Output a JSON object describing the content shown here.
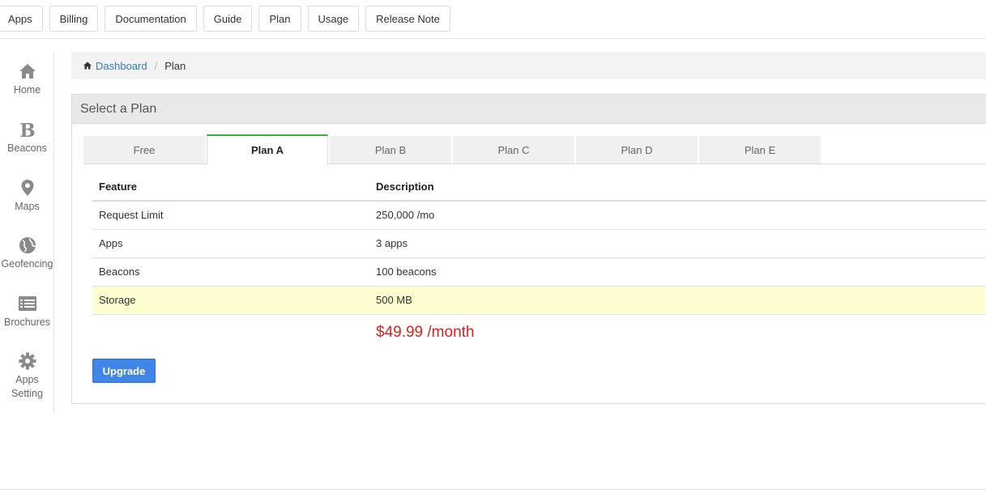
{
  "topnav": {
    "items": [
      {
        "label": "Apps"
      },
      {
        "label": "Billing"
      },
      {
        "label": "Documentation"
      },
      {
        "label": "Guide"
      },
      {
        "label": "Plan"
      },
      {
        "label": "Usage"
      },
      {
        "label": "Release Note"
      }
    ]
  },
  "sidebar": {
    "items": [
      {
        "label": "Home",
        "icon": "home-icon"
      },
      {
        "label": "Beacons",
        "icon": "beacon-b-icon"
      },
      {
        "label": "Maps",
        "icon": "map-pin-icon"
      },
      {
        "label": "Geofencing",
        "icon": "globe-icon"
      },
      {
        "label": "Brochures",
        "icon": "list-icon"
      },
      {
        "label": "Apps",
        "label2": "Setting",
        "icon": "gear-icon"
      }
    ]
  },
  "breadcrumb": {
    "home": "Dashboard",
    "separator": "/",
    "current": "Plan"
  },
  "panel": {
    "title": "Select a Plan"
  },
  "tabs": [
    {
      "label": "Free"
    },
    {
      "label": "Plan A"
    },
    {
      "label": "Plan B"
    },
    {
      "label": "Plan C"
    },
    {
      "label": "Plan D"
    },
    {
      "label": "Plan E"
    }
  ],
  "active_tab": "Plan A",
  "table": {
    "headers": [
      "Feature",
      "Description"
    ],
    "rows": [
      [
        "Request Limit",
        "250,000 /mo"
      ],
      [
        "Apps",
        "3 apps"
      ],
      [
        "Beacons",
        "100 beacons"
      ],
      [
        "Storage",
        "500 MB"
      ]
    ]
  },
  "price": "$49.99 /month",
  "upgrade_label": "Upgrade",
  "colors": {
    "accent_tab": "#3cb03c",
    "link": "#2f7fc4",
    "price": "#e0201f",
    "button": "#3f86e8",
    "highlight_row": "#fefed1"
  }
}
